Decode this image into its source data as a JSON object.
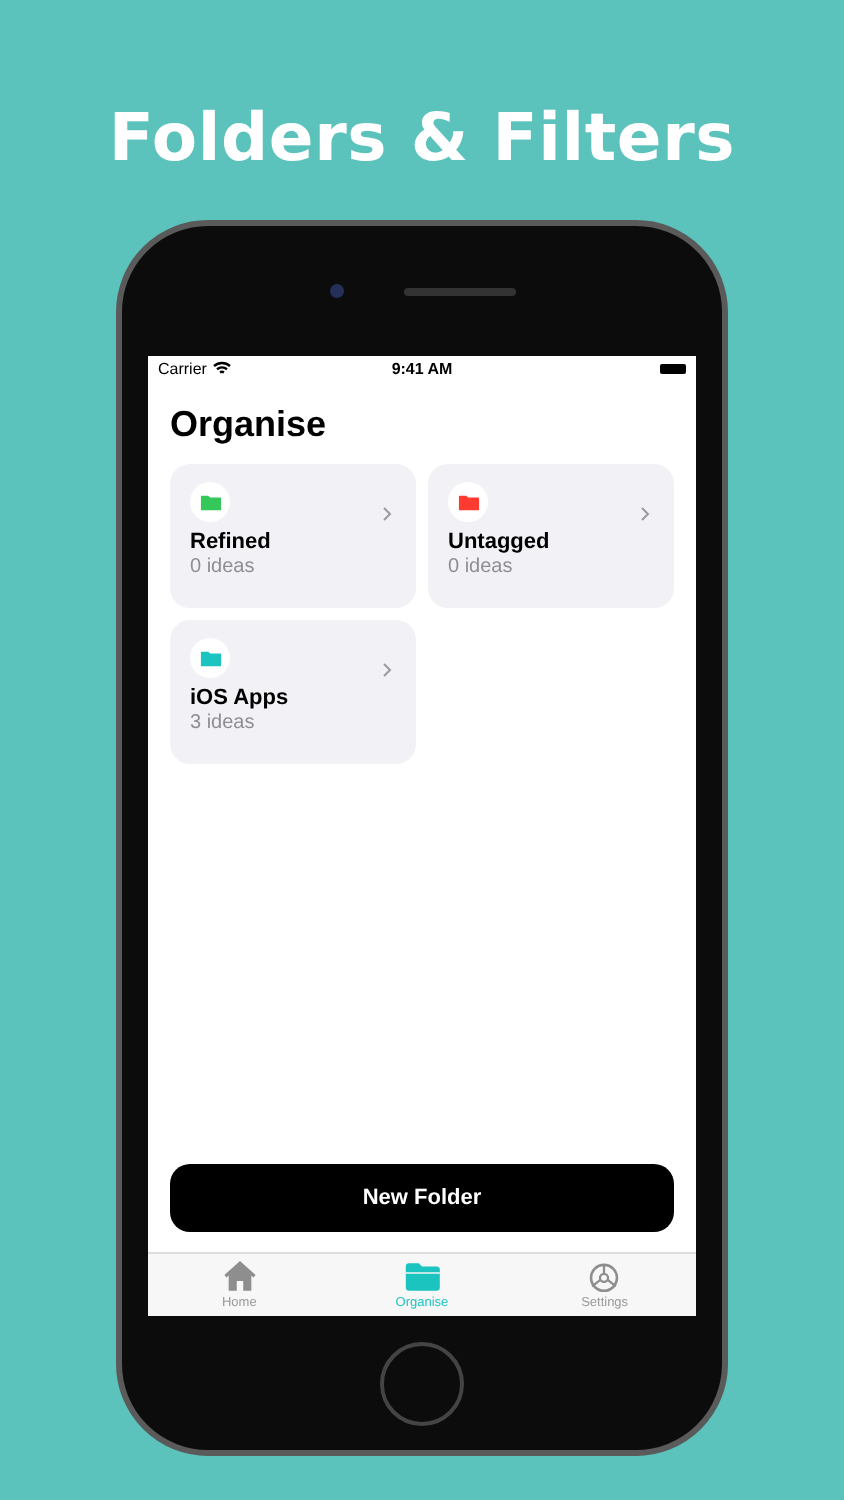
{
  "headline": "Folders & Filters",
  "status_bar": {
    "carrier": "Carrier",
    "time": "9:41 AM"
  },
  "title": "Organise",
  "folders": [
    {
      "name": "Refined",
      "count": "0 ideas",
      "color": "#34c759"
    },
    {
      "name": "Untagged",
      "count": "0 ideas",
      "color": "#ff3b30"
    },
    {
      "name": "iOS Apps",
      "count": "3 ideas",
      "color": "#1cc4c0"
    }
  ],
  "button": "New Folder",
  "tabs": [
    {
      "label": "Home",
      "kind": "home",
      "selected": false
    },
    {
      "label": "Organise",
      "kind": "folder",
      "selected": true
    },
    {
      "label": "Settings",
      "kind": "gear",
      "selected": false
    }
  ]
}
